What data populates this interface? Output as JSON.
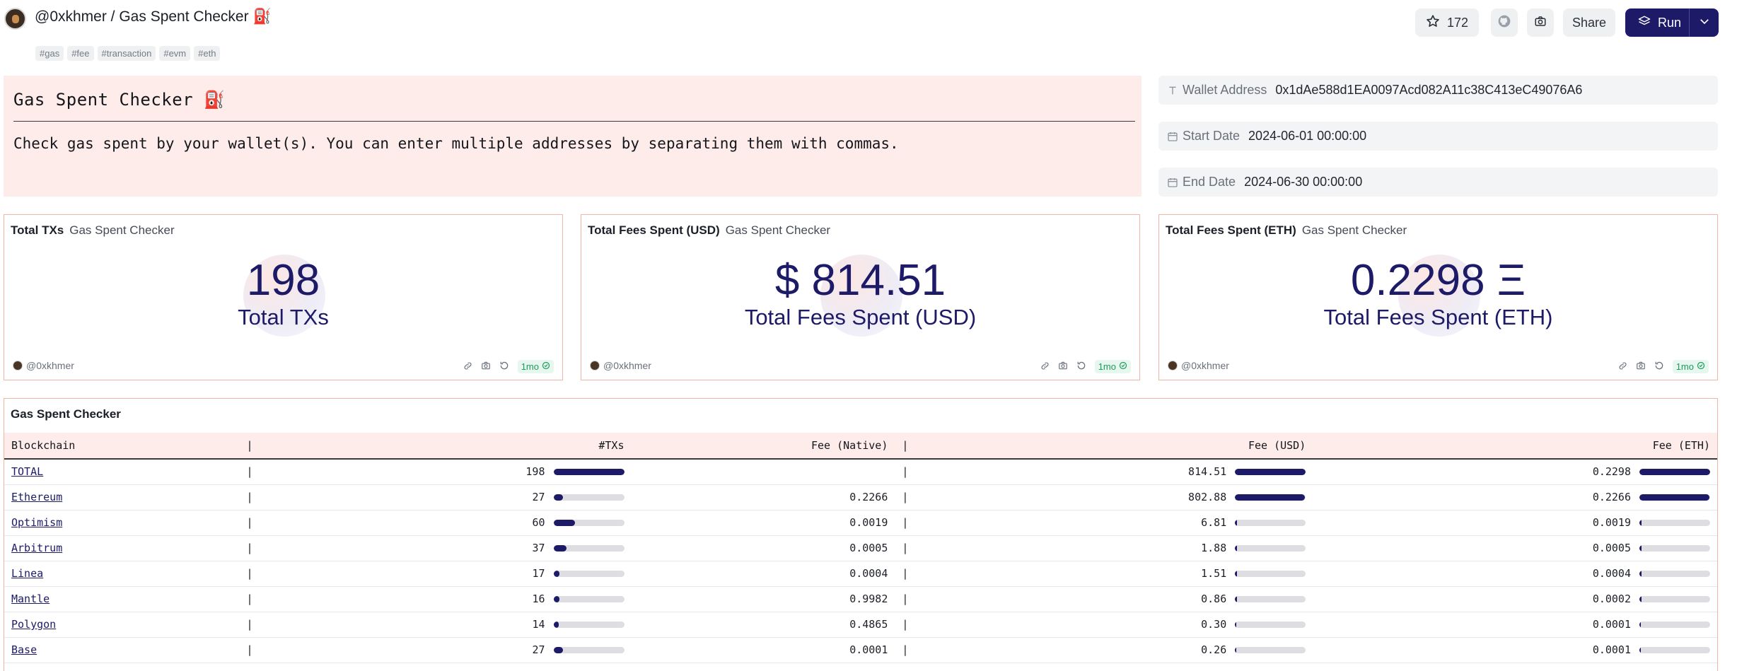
{
  "header": {
    "title": "@0xkhmer / Gas Spent Checker ⛽",
    "tags": [
      "#gas",
      "#fee",
      "#transaction",
      "#evm",
      "#eth"
    ],
    "star_count": "172",
    "share_label": "Share",
    "run_label": "Run",
    "accent_color": "#1d1a67"
  },
  "text_panel": {
    "title": "Gas Spent Checker ⛽",
    "description": "Check gas spent by your wallet(s). You can enter multiple addresses by separating them with commas."
  },
  "params": [
    {
      "icon": "text-icon",
      "label": "Wallet Address",
      "value": "0x1dAe588d1EA0097Acd082A11c38C413eC49076A6"
    },
    {
      "icon": "calendar-icon",
      "label": "Start Date",
      "value": "2024-06-01 00:00:00"
    },
    {
      "icon": "calendar-icon",
      "label": "End Date",
      "value": "2024-06-30 00:00:00"
    }
  ],
  "counters": [
    {
      "title": "Total TXs",
      "subtitle": "Gas Spent Checker",
      "value": "198",
      "label": "Total TXs",
      "author": "@0xkhmer",
      "freshness": "1mo"
    },
    {
      "title": "Total Fees Spent (USD)",
      "subtitle": "Gas Spent Checker",
      "value": "$ 814.51",
      "label": "Total Fees Spent (USD)",
      "author": "@0xkhmer",
      "freshness": "1mo"
    },
    {
      "title": "Total Fees Spent (ETH)",
      "subtitle": "Gas Spent Checker",
      "value": "0.2298 Ξ",
      "label": "Total Fees Spent (ETH)",
      "author": "@0xkhmer",
      "freshness": "1mo"
    }
  ],
  "table": {
    "title": "Gas Spent Checker",
    "columns": [
      "Blockchain",
      "|",
      "#TXs",
      "Fee (Native)",
      "|",
      "Fee (USD)",
      "Fee (ETH)"
    ],
    "rows": [
      {
        "chain": "TOTAL",
        "sep1": "|",
        "txs": "198",
        "txs_frac": 1.0,
        "fee_native": "",
        "sep2": "|",
        "fee_usd": "814.51",
        "usd_frac": 1.0,
        "fee_eth": "0.2298",
        "eth_frac": 1.0
      },
      {
        "chain": "Ethereum",
        "sep1": "|",
        "txs": "27",
        "txs_frac": 0.136,
        "fee_native": "0.2266",
        "sep2": "|",
        "fee_usd": "802.88",
        "usd_frac": 0.986,
        "fee_eth": "0.2266",
        "eth_frac": 0.986
      },
      {
        "chain": "Optimism",
        "sep1": "|",
        "txs": "60",
        "txs_frac": 0.303,
        "fee_native": "0.0019",
        "sep2": "|",
        "fee_usd": "6.81",
        "usd_frac": 0.008,
        "fee_eth": "0.0019",
        "eth_frac": 0.008
      },
      {
        "chain": "Arbitrum",
        "sep1": "|",
        "txs": "37",
        "txs_frac": 0.187,
        "fee_native": "0.0005",
        "sep2": "|",
        "fee_usd": "1.88",
        "usd_frac": 0.002,
        "fee_eth": "0.0005",
        "eth_frac": 0.002
      },
      {
        "chain": "Linea",
        "sep1": "|",
        "txs": "17",
        "txs_frac": 0.086,
        "fee_native": "0.0004",
        "sep2": "|",
        "fee_usd": "1.51",
        "usd_frac": 0.002,
        "fee_eth": "0.0004",
        "eth_frac": 0.002
      },
      {
        "chain": "Mantle",
        "sep1": "|",
        "txs": "16",
        "txs_frac": 0.081,
        "fee_native": "0.9982",
        "sep2": "|",
        "fee_usd": "0.86",
        "usd_frac": 0.001,
        "fee_eth": "0.0002",
        "eth_frac": 0.001
      },
      {
        "chain": "Polygon",
        "sep1": "|",
        "txs": "14",
        "txs_frac": 0.071,
        "fee_native": "0.4865",
        "sep2": "|",
        "fee_usd": "0.30",
        "usd_frac": 0.0,
        "fee_eth": "0.0001",
        "eth_frac": 0.0
      },
      {
        "chain": "Base",
        "sep1": "|",
        "txs": "27",
        "txs_frac": 0.136,
        "fee_native": "0.0001",
        "sep2": "|",
        "fee_usd": "0.26",
        "usd_frac": 0.0,
        "fee_eth": "0.0001",
        "eth_frac": 0.0
      }
    ]
  }
}
